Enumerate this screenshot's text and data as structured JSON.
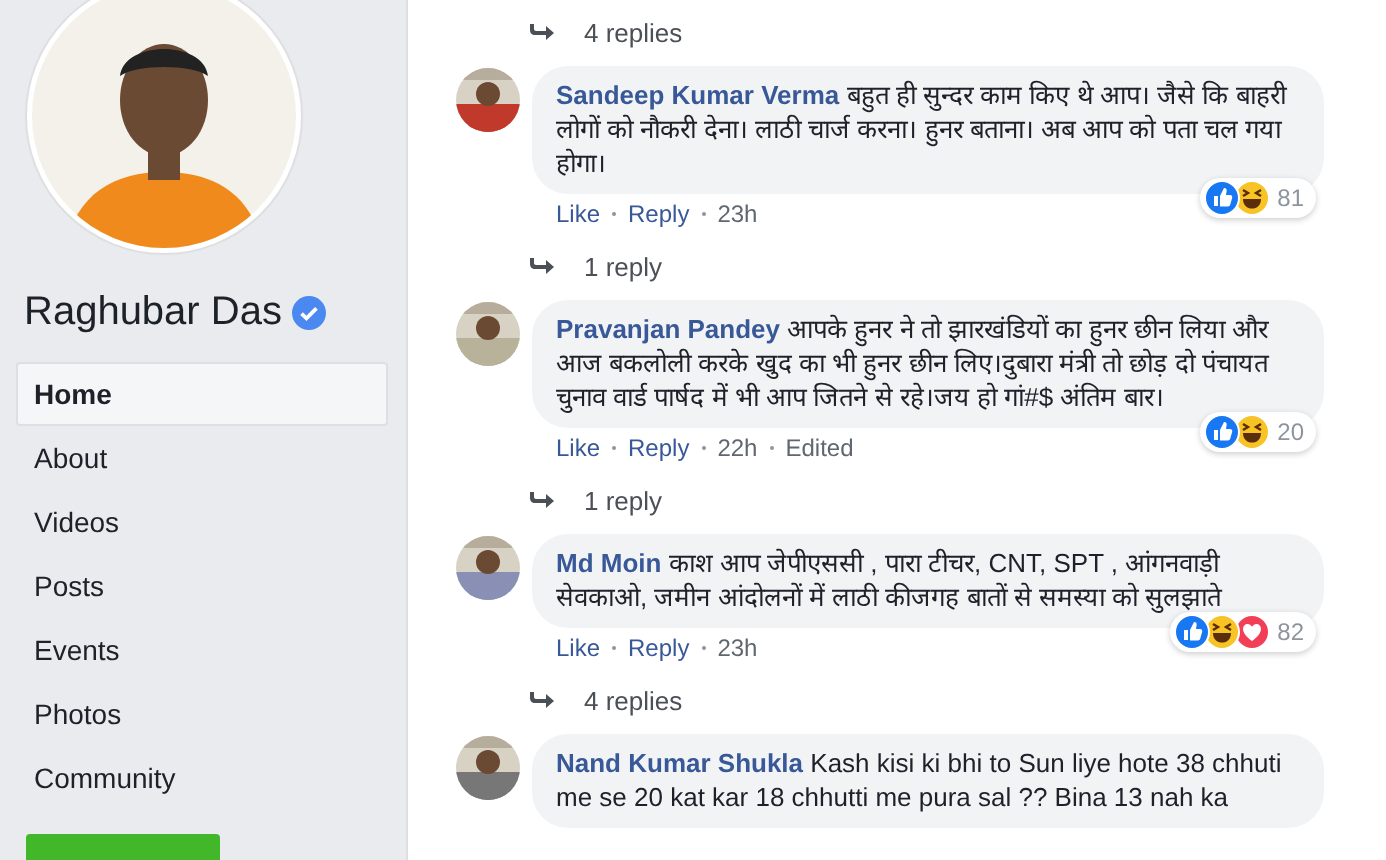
{
  "sidebar": {
    "page_name": "Raghubar Das",
    "verified": true,
    "nav": [
      {
        "label": "Home",
        "selected": true
      },
      {
        "label": "About",
        "selected": false
      },
      {
        "label": "Videos",
        "selected": false
      },
      {
        "label": "Posts",
        "selected": false
      },
      {
        "label": "Events",
        "selected": false
      },
      {
        "label": "Photos",
        "selected": false
      },
      {
        "label": "Community",
        "selected": false
      }
    ]
  },
  "feed": [
    {
      "kind": "replies",
      "label": "4 replies"
    },
    {
      "kind": "comment",
      "author": "Sandeep Kumar Verma",
      "text": "बहुत ही सुन्दर काम किए थे आप। जैसे कि बाहरी लोगों को नौकरी देना। लाठी चार्ज करना। हुनर बताना। अब आप को पता चल गया होगा।",
      "actions": [
        "Like",
        "Reply",
        "23h"
      ],
      "reactions": [
        {
          "kind": "like"
        },
        {
          "kind": "haha"
        }
      ],
      "reaction_count": "81"
    },
    {
      "kind": "replies",
      "label": "1 reply"
    },
    {
      "kind": "comment",
      "author": "Pravanjan Pandey",
      "text": "आपके हुनर ने तो झारखंडियों का हुनर छीन लिया और आज बकलोली करके खुद का भी हुनर छीन लिए।दुबारा मंत्री तो छोड़ दो पंचायत चुनाव वार्ड पार्षद में भी आप जितने से रहे।जय हो गां#$ अंतिम बार।",
      "actions": [
        "Like",
        "Reply",
        "22h",
        "Edited"
      ],
      "reactions": [
        {
          "kind": "like"
        },
        {
          "kind": "haha"
        }
      ],
      "reaction_count": "20"
    },
    {
      "kind": "replies",
      "label": "1 reply"
    },
    {
      "kind": "comment",
      "author": "Md Moin",
      "text": "काश आप जेपीएससी , पारा टीचर, CNT, SPT , आंगनवाड़ी सेवकाओ, जमीन आंदोलनों में लाठी कीजगह बातों से समस्या को सुलझाते",
      "actions": [
        "Like",
        "Reply",
        "23h"
      ],
      "reactions": [
        {
          "kind": "like"
        },
        {
          "kind": "haha"
        },
        {
          "kind": "love"
        }
      ],
      "reaction_count": "82"
    },
    {
      "kind": "replies",
      "label": "4 replies"
    },
    {
      "kind": "comment",
      "author": "Nand Kumar Shukla",
      "text": "Kash kisi ki bhi to Sun liye hote 38 chhuti me se 20 kat kar 18 chhutti me pura sal ?? Bina 13 nah ka"
    }
  ]
}
